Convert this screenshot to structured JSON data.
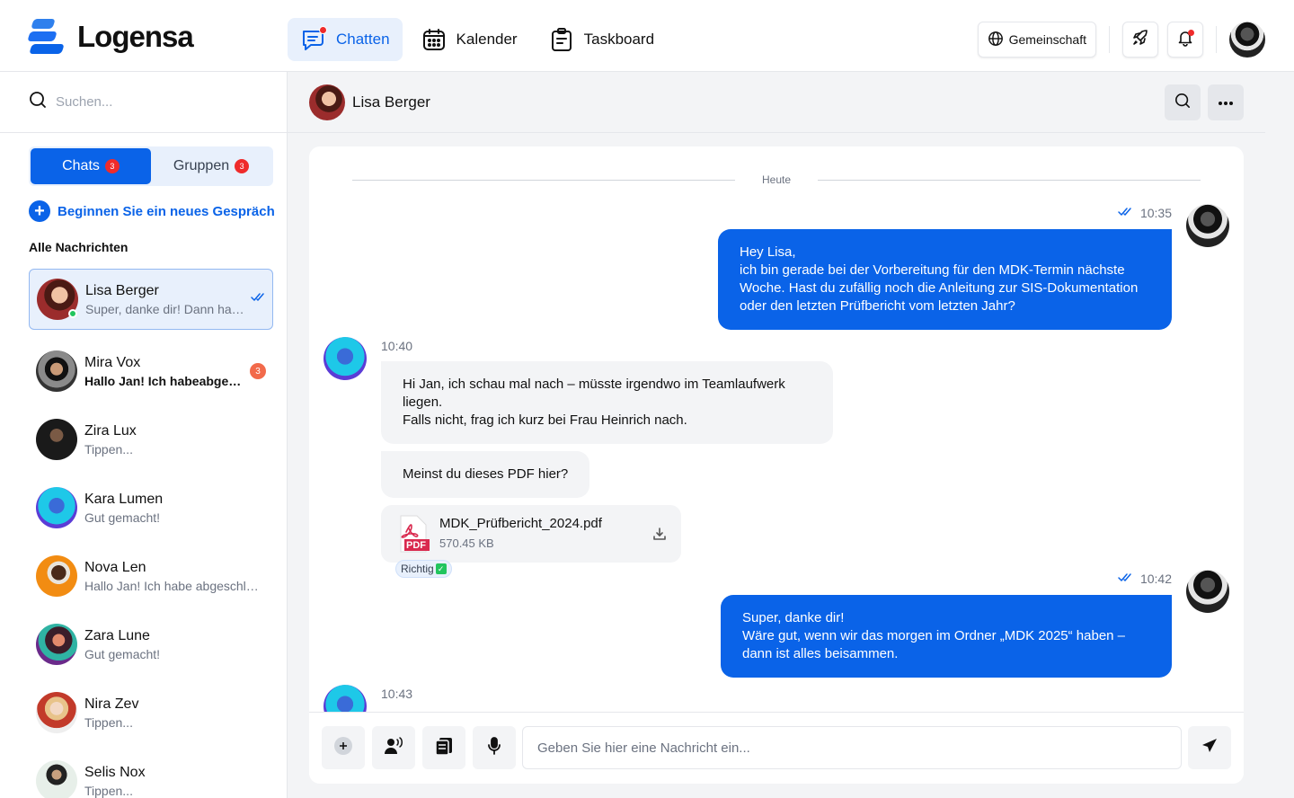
{
  "app": {
    "name": "Logensa",
    "brand_color": "#0a63e8"
  },
  "nav": {
    "items": [
      {
        "label": "Chatten",
        "icon": "chat-icon",
        "active": true
      },
      {
        "label": "Kalender",
        "icon": "calendar-icon",
        "active": false
      },
      {
        "label": "Taskboard",
        "icon": "clipboard-icon",
        "active": false
      }
    ]
  },
  "topbar": {
    "community_label": "Gemeinschaft"
  },
  "sidebar": {
    "search_placeholder": "Suchen...",
    "tabs": [
      {
        "label": "Chats",
        "badge": "3",
        "active": true
      },
      {
        "label": "Gruppen",
        "badge": "3",
        "active": false
      }
    ],
    "new_chat_label": "Beginnen Sie ein neues Gespräch",
    "section_title": "Alle Nachrichten",
    "chats": [
      {
        "name": "Lisa Berger",
        "preview": "Super, danke dir! Dann habe ich alles zusammen.",
        "active": true,
        "online": true,
        "read": true,
        "unread": ""
      },
      {
        "name": "Mira Vox",
        "preview": "Hallo Jan! Ich habeabgeschlossen",
        "bold": true,
        "unread": "3"
      },
      {
        "name": "Zira Lux",
        "preview": "Tippen..."
      },
      {
        "name": "Kara Lumen",
        "preview": "Gut gemacht!"
      },
      {
        "name": "Nova Len",
        "preview": "Hallo Jan! Ich habe abgeschlossen"
      },
      {
        "name": "Zara Lune",
        "preview": "Gut gemacht!"
      },
      {
        "name": "Nira Zev",
        "preview": "Tippen..."
      },
      {
        "name": "Selis Nox",
        "preview": "Tippen..."
      }
    ]
  },
  "conversation": {
    "contact_name": "Lisa Berger",
    "day_label": "Heute",
    "messages": [
      {
        "direction": "out",
        "time": "10:35",
        "text": "Hey Lisa,\nich bin gerade bei der Vorbereitung für den MDK-Termin nächste Woche. Hast du zufällig noch die Anleitung zur SIS-Dokumentation oder den letzten Prüfbericht vom letzten Jahr?"
      },
      {
        "direction": "in",
        "time": "10:40",
        "text": "Hi Jan, ich schau mal nach – müsste irgendwo im Teamlaufwerk liegen.\n Falls nicht, frag ich kurz bei Frau Heinrich nach."
      },
      {
        "direction": "in",
        "text": "Meinst du dieses PDF hier?"
      },
      {
        "direction": "in",
        "file": {
          "name": "MDK_Prüfbericht_2024.pdf",
          "size": "570.45 KB",
          "type_label": "PDF"
        },
        "reaction": "Richtig"
      },
      {
        "direction": "out",
        "time": "10:42",
        "text": "Super, danke dir!\n Wäre gut, wenn wir das morgen im Ordner „MDK 2025“ haben – dann ist alles beisammen."
      },
      {
        "direction": "in",
        "time": "10:43"
      }
    ]
  },
  "composer": {
    "placeholder": "Geben Sie hier eine Nachricht ein..."
  }
}
